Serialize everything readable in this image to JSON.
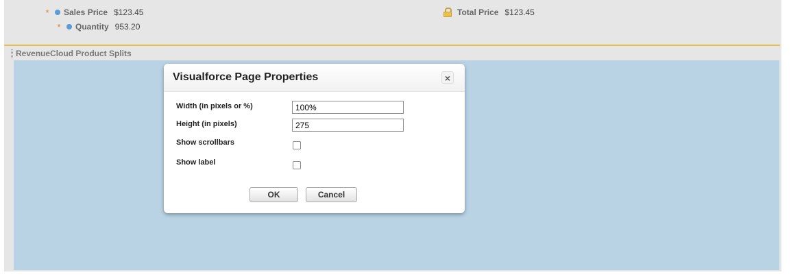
{
  "fields": {
    "sales_price": {
      "label": "Sales Price",
      "value": "$123.45"
    },
    "quantity": {
      "label": "Quantity",
      "value": "953.20"
    },
    "total_price": {
      "label": "Total Price",
      "value": "$123.45"
    },
    "required_marker": "*"
  },
  "section": {
    "title": "RevenueCloud Product Splits"
  },
  "dialog": {
    "title": "Visualforce Page Properties",
    "close_glyph": "×",
    "width_label": "Width (in pixels or %)",
    "width_value": "100%",
    "height_label": "Height (in pixels)",
    "height_value": "275",
    "scrollbars_label": "Show scrollbars",
    "scrollbars_checked": false,
    "show_label_label": "Show label",
    "show_label_checked": false,
    "ok_label": "OK",
    "cancel_label": "Cancel"
  },
  "colors": {
    "required_star": "#e8822a",
    "field_dot": "#5b9bd5",
    "section_rule": "#e8c04a",
    "visualforce_area": "#b9d3e5",
    "lock": "#e8c04a"
  },
  "icons": {
    "required": "asterisk-icon",
    "field_dot": "dot-icon",
    "lock": "lock-icon",
    "close": "close-icon",
    "grip": "drag-handle-icon"
  }
}
